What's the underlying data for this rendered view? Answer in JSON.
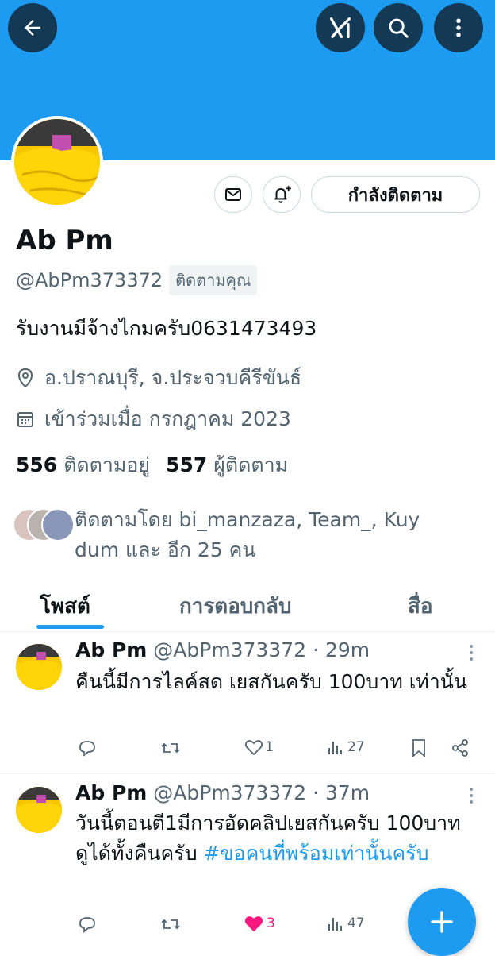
{
  "profile": {
    "name": "Ab Pm",
    "handle": "@AbPm373372",
    "follows_you_label": "ติดตามคุณ",
    "bio": "รับงานมีจ้างไกมครับ0631473493",
    "location": "อ.ปราณบุรี, จ.ประจวบคีรีขันธ์",
    "joined": "เข้าร่วมเมื่อ กรกฎาคม 2023",
    "following_count": "556",
    "following_label": "ติดตามอยู่",
    "followers_count": "557",
    "followers_label": "ผู้ติดตาม",
    "followed_by": "ติดตามโดย bi_manzaza, Team_, Kuy dum และ อีก 25 คน",
    "following_button_label": "กำลังติดตาม"
  },
  "tabs": [
    {
      "label": "โพสต์",
      "active": true
    },
    {
      "label": "การตอบกลับ",
      "active": false
    },
    {
      "label": "สื่อ",
      "active": false
    }
  ],
  "posts": [
    {
      "name": "Ab Pm",
      "meta": "@AbPm373372 · 29m",
      "text": "คืนนี้มีการไลค์สด เยสกันครับ 100บาท เท่านั้น",
      "hashtag": "",
      "likes": "1",
      "liked": false,
      "views": "27"
    },
    {
      "name": "Ab Pm",
      "meta": "@AbPm373372 · 37m",
      "text": "วันนี้ตอนตี1มีการอัดคลิปเยสกันครับ 100บาทดูได้ทั้งคืนครับ ",
      "hashtag": "#ขอคนที่พร้อมเท่านั้นครับ",
      "likes": "3",
      "liked": true,
      "views": "47"
    }
  ],
  "colors": {
    "accent": "#1d9bf0",
    "like": "#f91880",
    "muted": "#536471"
  }
}
